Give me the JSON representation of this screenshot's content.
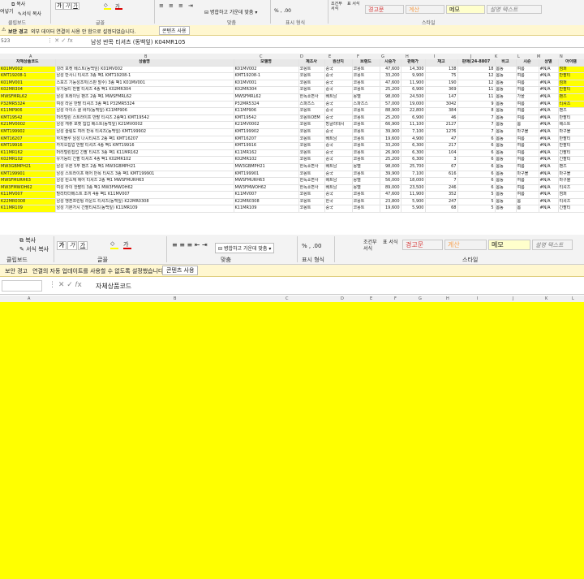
{
  "top_ribbon": {
    "btn_copy": "복사",
    "btn_format_painter": "서식 복사",
    "btn_paste_partial": "여넣기",
    "grp_clipboard": "클립보드",
    "grp_font": "글꼴",
    "grp_align": "맞춤",
    "grp_number": "표시 형식",
    "grp_styles": "스타일",
    "merge_label": "병합하고 가운데 맞춤",
    "cond_format": "조건부 서식",
    "table_format": "표 서식",
    "style_warning": "경고문",
    "style_calc": "계산",
    "style_memo": "메모",
    "style_explain": "설명 텍스트"
  },
  "top_msgbar": {
    "title": "보안 경고",
    "text": "외부 데이터 연결이 사용 안 함으로 설정되었습니다.",
    "button": "콘텐츠 사용"
  },
  "top_formula": {
    "name_box": "523",
    "content": "남성 반목 티셔츠 (동백잎) K04MR105"
  },
  "sheet": {
    "headers": [
      "자체상품코드",
      "상품명",
      "모델명",
      "제조사",
      "원산지",
      "브랜드",
      "시중가",
      "판매가",
      "재고",
      "판매(24-8807",
      "비고",
      "시즌",
      "상별",
      "아이템"
    ],
    "rows": [
      [
        "K01MV002",
        "컬러 포켓 베스트(동백잎) K01MV002",
        "K01MV002",
        "코몽트",
        "중국",
        "코몽트",
        "47,600",
        "14,300",
        "138",
        "18",
        "봄동",
        "여름",
        "#N/A",
        "점퍼"
      ],
      [
        "KMT19208-1",
        "남성 반사니 티셔츠 3종 팩1 KMT19208-1",
        "KMT19208-1",
        "코몽트",
        "중국",
        "코몽트",
        "33,200",
        "9,900",
        "75",
        "12",
        "봄동",
        "여름",
        "#N/A",
        "반팔티"
      ],
      [
        "K01MV001",
        "스포츠 기능성조끼(스판 발수) 3종 팩1 K01MV001",
        "K01MV001",
        "코몽트",
        "중국",
        "코몽트",
        "47,600",
        "11,900",
        "190",
        "12",
        "봄동",
        "여름",
        "#N/A",
        "점퍼"
      ],
      [
        "K02MR304",
        "유기농티 반팔 티셔츠 4종 팩1 K02MR304",
        "K02MR304",
        "코몽트",
        "중국",
        "코몽트",
        "25,200",
        "6,900",
        "369",
        "11",
        "봄동",
        "여름",
        "#N/A",
        "반팔티"
      ],
      [
        "MWSFMRL62",
        "남성 트레이닝 팬츠 2종 팩1 MWSFMRL62",
        "MWSFMRL62",
        "한독쇼면사",
        "베트남",
        "몽벨",
        "98,000",
        "24,500",
        "147",
        "11",
        "봄동",
        "가을",
        "#N/A",
        "팬츠"
      ],
      [
        "P32MR5324",
        "여성 라운 반팔 티셔츠 3종 팩1 P32MR5324",
        "P32MR5324",
        "스파즈스",
        "중국",
        "스파즈스",
        "57,000",
        "19,000",
        "3042",
        "9",
        "봄동",
        "여름",
        "#N/A",
        "티셔츠"
      ],
      [
        "K11MP906",
        "남성 아이스 쿨 바지(동백잎) K11MP906",
        "K11MP906",
        "코몽트",
        "중국",
        "코몽트",
        "88,900",
        "22,800",
        "384",
        "8",
        "봄동",
        "여름",
        "#N/A",
        "팬츠"
      ],
      [
        "KMT19542",
        "머리털린 스트라이프 반팔 티셔츠 2종팩1 KMT19542",
        "KMT19542",
        "코몽트OEM",
        "중국",
        "코몽트",
        "25,200",
        "6,900",
        "46",
        "7",
        "봄동",
        "여름",
        "#N/A",
        "반팔티"
      ],
      [
        "K21MV0002",
        "남성 캐쥬 포켓 집업 베스트(동백잎) K21MV0002",
        "K21MV0002",
        "코몽트",
        "방글라데시",
        "코몽트",
        "66,900",
        "11,100",
        "2127",
        "7",
        "봄동",
        "봄",
        "#N/A",
        "베스트"
      ],
      [
        "KMT199902",
        "남성 슬림도 여러 반목 티셔츠(동백잎) KMT199902",
        "KMT199902",
        "코몽트",
        "중국",
        "코몽트",
        "39,900",
        "7,100",
        "1276",
        "7",
        "봄동",
        "마구볼",
        "#N/A",
        "마구볼"
      ],
      [
        "KMT16207",
        "하치블루 남성 나시티셔츠 2종 팩1 KMT16207",
        "KMT16207",
        "코몽트",
        "베트남",
        "코몽트",
        "19,600",
        "4,900",
        "47",
        "6",
        "봄동",
        "여름",
        "#N/A",
        "반팔티"
      ],
      [
        "KMT19916",
        "카치오집업 반팔 티셔츠 4종 팩1 KMT19916",
        "KMT19916",
        "코몽트",
        "중국",
        "코몽트",
        "33,200",
        "6,300",
        "217",
        "6",
        "봄동",
        "여름",
        "#N/A",
        "반팔티"
      ],
      [
        "K11MR162",
        "머리털린집업 긴팔 티셔츠 3종 팩1 K11MR162",
        "K11MR162",
        "코몽트",
        "중국",
        "코몽트",
        "26,900",
        "6,300",
        "104",
        "6",
        "봄동",
        "여름",
        "#N/A",
        "긴팔티"
      ],
      [
        "K02MR102",
        "유기농티 긴팔 티셔츠 4종 팩1 K02MR102",
        "K02MR102",
        "코몽트",
        "중국",
        "코몽트",
        "25,200",
        "6,300",
        "3",
        "6",
        "봄동",
        "여름",
        "#N/A",
        "긴팔티"
      ],
      [
        "MW3GBMPH21",
        "남성 우븐 5부 팬츠 2종 팩1 MW3GBMPH21",
        "MW3GBMPH21",
        "한독쇼면사",
        "베트남",
        "몽벨",
        "98,000",
        "25,700",
        "67",
        "6",
        "봄동",
        "여름",
        "#N/A",
        "팬츠"
      ],
      [
        "KMT199901",
        "남성 스트라이프 에어 반목 티셔츠 3종 팩1 KMT199901",
        "KMT199901",
        "코몽트",
        "중국",
        "코몽트",
        "39,900",
        "7,100",
        "616",
        "6",
        "봄동",
        "마구볼",
        "#N/A",
        "마구볼"
      ],
      [
        "MWSFMURH63",
        "남성 린소재 에어 티셔츠 2종 팩1 MWSFMURH63",
        "MWSFMURH63",
        "한독쇼면사",
        "베트남",
        "몽벨",
        "56,000",
        "18,000",
        "7",
        "6",
        "봄동",
        "여름",
        "#N/A",
        "마구볼"
      ],
      [
        "MW3FMWOH62",
        "여성 라이 한팔티 3종 팩1 MW3FMWOH62",
        "MW3FMWOH62",
        "한독쇼면사",
        "베트남",
        "몽벨",
        "89,000",
        "23,500",
        "246",
        "6",
        "봄동",
        "여름",
        "#N/A",
        "티셔츠"
      ],
      [
        "K11MV007",
        "필리터더베스트 조끼 4종 팩1 K11MV007",
        "K11MV007",
        "코몽트",
        "중국",
        "코몽트",
        "47,600",
        "11,900",
        "352",
        "5",
        "봄동",
        "여름",
        "#N/A",
        "점퍼"
      ],
      [
        "K22MR0308",
        "남성 맹혼프린팅 라운드 티셔츠(동백잎) K22MR0308",
        "K22MR0308",
        "코몽트",
        "한국",
        "코몽트",
        "23,800",
        "5,900",
        "247",
        "5",
        "봄동",
        "봄",
        "#N/A",
        "티셔츠"
      ],
      [
        "K11MR109",
        "남성 기본가시 긴팔티셔츠(동백잎) K11MR109",
        "K11MR109",
        "코몽트",
        "중국",
        "코몽트",
        "19,600",
        "5,900",
        "68",
        "5",
        "봄동",
        "봄",
        "#N/A",
        "긴팔티"
      ]
    ]
  },
  "lower_ribbon": {
    "btn_copy": "복사",
    "btn_format_painter": "서식 복사",
    "grp_clipboard": "클립보드",
    "grp_font": "글꼴",
    "grp_align": "맞춤",
    "grp_number": "표시 형식",
    "grp_styles": "스타일",
    "merge_label": "병합하고 가운데 맞춤",
    "cond_format": "조건부 서식",
    "table_format": "표 서식",
    "style_warning": "경고문",
    "style_calc": "계산",
    "style_memo": "메모",
    "style_explain": "설명 텍스트",
    "insert": "삽입",
    "delete": "삭제",
    "format": "서식"
  },
  "lower_msgbar": {
    "title": "보안 경고",
    "text": "연결의 자동 업데이트를 사용할 수 없도록 설정했습니다.",
    "button": "콘텐츠 사용"
  },
  "lower_formula": {
    "content": "자체상품코드"
  },
  "lower_columns": [
    "A",
    "B",
    "C",
    "D",
    "E",
    "F",
    "G",
    "H",
    "I",
    "J",
    "K",
    "L"
  ],
  "colors": {
    "yellow": "#ffff00",
    "warning_red": "#d63b3b",
    "calc_orange": "#f6a04d",
    "memo_yellow": "#ffffcc"
  }
}
